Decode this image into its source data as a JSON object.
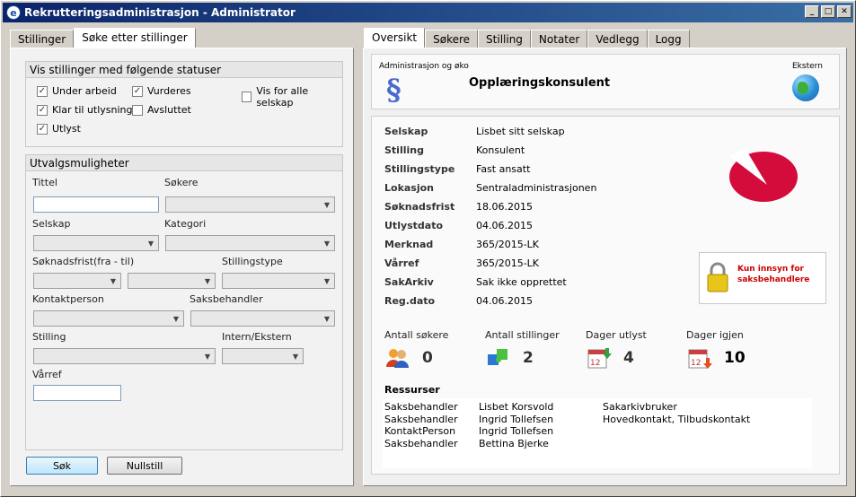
{
  "window": {
    "title": "Rekrutteringsadministrasjon - Administrator",
    "icon": "app-e-icon",
    "controls": [
      "_",
      "□",
      "✕"
    ]
  },
  "left": {
    "tabs": [
      "Stillinger",
      "Søke etter stillinger"
    ],
    "status_group": {
      "title": "Vis stillinger med følgende statuser",
      "checkboxes": [
        {
          "label": "Under arbeid",
          "checked": true
        },
        {
          "label": "Vurderes",
          "checked": true
        },
        {
          "label": "Vis for alle selskap",
          "checked": false
        },
        {
          "label": "Klar til utlysning",
          "checked": true
        },
        {
          "label": "Avsluttet",
          "checked": false
        },
        {
          "label": "Utlyst",
          "checked": true
        }
      ]
    },
    "filter_group": {
      "title": "Utvalgsmuligheter",
      "labels": {
        "tittel": "Tittel",
        "sokere": "Søkere",
        "selskap": "Selskap",
        "kategori": "Kategori",
        "soknadsfrist": "Søknadsfrist(fra - til)",
        "stillingstype": "Stillingstype",
        "kontaktperson": "Kontaktperson",
        "saksbehandler": "Saksbehandler",
        "stilling": "Stilling",
        "intern_ekstern": "Intern/Ekstern",
        "varref": "Vårref"
      }
    },
    "buttons": {
      "search": "Søk",
      "reset": "Nullstill"
    }
  },
  "right": {
    "tabs": [
      "Oversikt",
      "Søkere",
      "Stilling",
      "Notater",
      "Vedlegg",
      "Logg"
    ],
    "header": {
      "category": "Administrasjon og øko",
      "title": "Opplæringskonsulent",
      "external_label": "Ekstern",
      "category_icon": "paragraph-icon",
      "external_icon": "globe-icon"
    },
    "details": [
      {
        "key": "Selskap",
        "value": "Lisbet sitt selskap"
      },
      {
        "key": "Stilling",
        "value": "Konsulent"
      },
      {
        "key": "Stillingstype",
        "value": "Fast ansatt"
      },
      {
        "key": "Lokasjon",
        "value": "Sentraladministrasjonen"
      },
      {
        "key": "Søknadsfrist",
        "value": "18.06.2015"
      },
      {
        "key": "Utlystdato",
        "value": "04.06.2015"
      },
      {
        "key": "Merknad",
        "value": "365/2015-LK"
      },
      {
        "key": "Vårref",
        "value": "365/2015-LK"
      },
      {
        "key": "SakArkiv",
        "value": "Sak ikke opprettet"
      },
      {
        "key": "Reg.dato",
        "value": "04.06.2015"
      }
    ],
    "restricted": {
      "label": "Kun innsyn for saksbehandlere",
      "icon": "padlock-icon"
    },
    "stats": [
      {
        "label": "Antall søkere",
        "value": "0",
        "icon": "people-icon"
      },
      {
        "label": "Antall stillinger",
        "value": "2",
        "icon": "puzzle-icon"
      },
      {
        "label": "Dager utlyst",
        "value": "4",
        "icon": "calendar-up-icon"
      },
      {
        "label": "Dager igjen",
        "value": "10",
        "icon": "calendar-down-icon"
      }
    ],
    "resources": {
      "title": "Ressurser",
      "rows": [
        [
          "Saksbehandler",
          "Lisbet Korsvold",
          "Sakarkivbruker"
        ],
        [
          "Saksbehandler",
          "Ingrid Tollefsen",
          "Hovedkontakt, Tilbudskontakt"
        ],
        [
          "KontaktPerson",
          "Ingrid Tollefsen",
          ""
        ],
        [
          "Saksbehandler",
          "Bettina Bjerke",
          ""
        ]
      ]
    }
  }
}
